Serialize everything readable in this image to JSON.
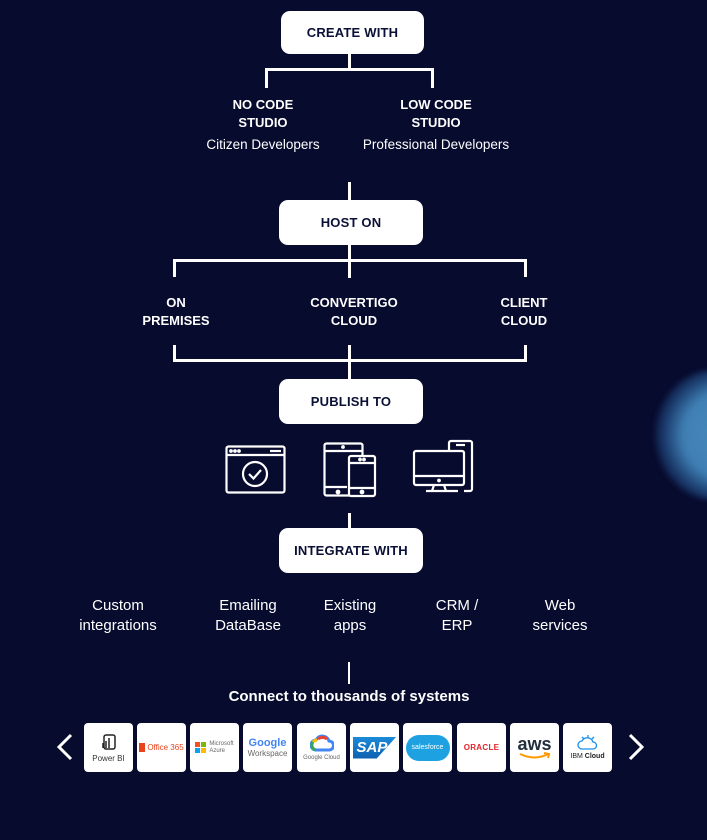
{
  "create": {
    "title": "CREATE WITH",
    "options": [
      {
        "label_line1": "NO CODE",
        "label_line2": "STUDIO",
        "audience": "Citizen Developers"
      },
      {
        "label_line1": "LOW CODE",
        "label_line2": "STUDIO",
        "audience": "Professional Developers"
      }
    ]
  },
  "host": {
    "title": "HOST ON",
    "options": [
      {
        "line1": "ON",
        "line2": "PREMISES"
      },
      {
        "line1": "CONVERTIGO",
        "line2": "CLOUD"
      },
      {
        "line1": "CLIENT",
        "line2": "CLOUD"
      }
    ]
  },
  "publish": {
    "title": "PUBLISH TO",
    "icons": [
      "web-app-icon",
      "mobile-tablet-icon",
      "desktop-mobile-icon"
    ]
  },
  "integrate": {
    "title": "INTEGRATE WITH",
    "items": [
      {
        "line1": "Custom",
        "line2": "integrations"
      },
      {
        "line1": "Emailing",
        "line2": "DataBase"
      },
      {
        "line1": "Existing",
        "line2": "apps"
      },
      {
        "line1": "CRM /",
        "line2": "ERP"
      },
      {
        "line1": "Web",
        "line2": "services"
      }
    ]
  },
  "connect": {
    "title": "Connect to thousands of systems",
    "logos": [
      {
        "name": "Power BI",
        "text": "Power BI"
      },
      {
        "name": "Office 365",
        "text": "Office 365"
      },
      {
        "name": "Microsoft Azure",
        "text1": "Microsoft",
        "text2": "Azure"
      },
      {
        "name": "Google Workspace",
        "text1": "Google",
        "text2": "Workspace"
      },
      {
        "name": "Google Cloud",
        "text": "Google Cloud"
      },
      {
        "name": "SAP",
        "text": "SAP"
      },
      {
        "name": "Salesforce",
        "text": "salesforce"
      },
      {
        "name": "Oracle",
        "text": "ORACLE"
      },
      {
        "name": "AWS",
        "text": "aws"
      },
      {
        "name": "IBM Cloud",
        "text1": "IBM",
        "text2": "Cloud"
      }
    ],
    "prev_label": "‹",
    "next_label": "›"
  },
  "colors": {
    "background": "#070b2e",
    "box": "#ffffff",
    "box_text": "#0b1036",
    "accent_blob": "#4a8bbd"
  }
}
